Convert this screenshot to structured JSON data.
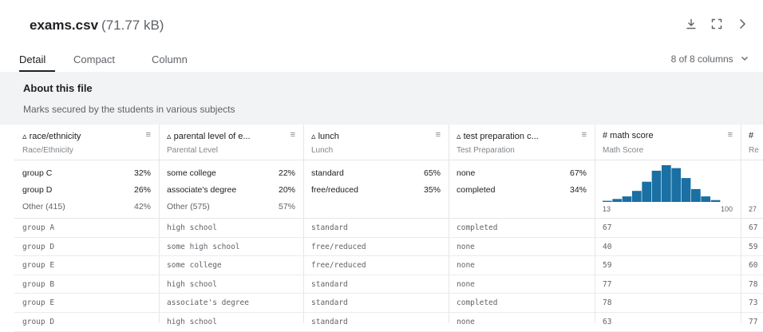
{
  "file": {
    "name": "exams.csv",
    "size": "(71.77 kB)"
  },
  "header_icons": {
    "download": "download-icon",
    "expand": "expand-icon",
    "next": "chevron-right-icon"
  },
  "tabs": [
    {
      "label": "Detail"
    },
    {
      "label": "Compact"
    },
    {
      "label": "Column"
    }
  ],
  "column_selector": "8 of 8 columns",
  "about": {
    "title": "About this file",
    "description": "Marks secured by the students in various subjects"
  },
  "columns": [
    {
      "type_icon": "▵",
      "name": "race/ethnicity",
      "subtitle": "Race/Ethnicity",
      "stats": [
        {
          "label": "group C",
          "pct": "32%"
        },
        {
          "label": "group D",
          "pct": "26%"
        },
        {
          "label": "Other (415)",
          "pct": "42%"
        }
      ],
      "rows": [
        "group A",
        "group D",
        "group E",
        "group B",
        "group E",
        "group D"
      ]
    },
    {
      "type_icon": "▵",
      "name": "parental level of e...",
      "subtitle": "Parental Level",
      "stats": [
        {
          "label": "some college",
          "pct": "22%"
        },
        {
          "label": "associate's degree",
          "pct": "20%"
        },
        {
          "label": "Other (575)",
          "pct": "57%"
        }
      ],
      "rows": [
        "high school",
        "some high school",
        "some college",
        "high school",
        "associate's degree",
        "high school"
      ]
    },
    {
      "type_icon": "▵",
      "name": "lunch",
      "subtitle": "Lunch",
      "stats": [
        {
          "label": "standard",
          "pct": "65%"
        },
        {
          "label": "free/reduced",
          "pct": "35%"
        }
      ],
      "rows": [
        "standard",
        "free/reduced",
        "free/reduced",
        "standard",
        "standard",
        "standard"
      ]
    },
    {
      "type_icon": "▵",
      "name": "test preparation c...",
      "subtitle": "Test Preparation",
      "stats": [
        {
          "label": "none",
          "pct": "67%"
        },
        {
          "label": "completed",
          "pct": "34%"
        }
      ],
      "rows": [
        "completed",
        "none",
        "none",
        "none",
        "completed",
        "none"
      ]
    },
    {
      "type_icon": "#",
      "name": "math score",
      "subtitle": "Math Score",
      "hist": {
        "min": "13",
        "max": "100",
        "bars": [
          0.03,
          0.08,
          0.15,
          0.3,
          0.55,
          0.85,
          1.0,
          0.92,
          0.65,
          0.35,
          0.15,
          0.05
        ],
        "color": "#1a6fa3"
      },
      "rows": [
        "67",
        "40",
        "59",
        "77",
        "78",
        "63"
      ]
    },
    {
      "type_icon": "#",
      "name": "",
      "subtitle": "Re",
      "hist": {
        "min": "27"
      },
      "rows": [
        "67",
        "59",
        "60",
        "78",
        "73",
        "77"
      ]
    }
  ]
}
